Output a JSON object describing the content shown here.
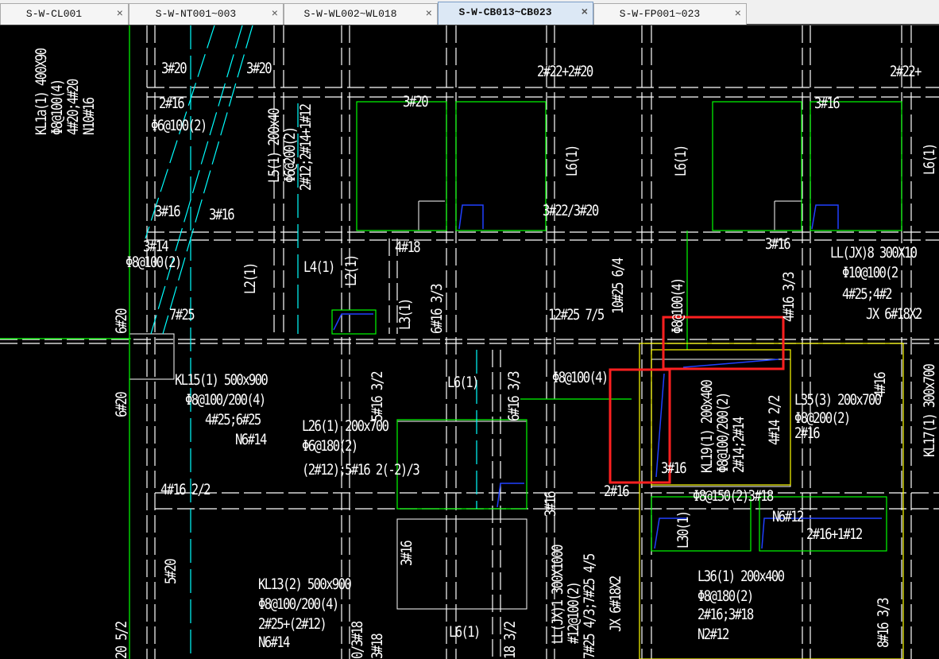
{
  "tabs": [
    {
      "label": "S-W-CL001",
      "active": false
    },
    {
      "label": "S-W-NT001~003",
      "active": false
    },
    {
      "label": "S-W-WL002~WL018",
      "active": false
    },
    {
      "label": "S-W-CB013~CB023",
      "active": true
    },
    {
      "label": "S-W-FP001~023",
      "active": false
    }
  ],
  "close_glyph": "×",
  "labels": [
    "3#20",
    "3#20",
    "2#22+2#20",
    "2#22+",
    "2#16",
    "Φ6@100(2)",
    "3#20",
    "3#16",
    "3#16",
    "3#16",
    "3#22/3#20",
    "3#14",
    "Φ8@100(2)",
    "4#18",
    "3#16",
    "LL(JX)8 300X10",
    "Φ10@100(2",
    "4#25;4#2",
    "JX 6#18X2",
    "7#25",
    "12#25 7/5",
    "KL15(1) 500x900",
    "Φ8@100/200(4)",
    "4#25;6#25",
    "N6#14",
    "L6(1)",
    "Φ8@100(4)",
    "L26(1) 200x700",
    "Φ6@180(2)",
    "(2#12);5#16 2(-2)/3",
    "L35(3) 200x700",
    "Φ8@200(2)",
    "2#16",
    "3#16",
    "4#16 2/2",
    "2#16",
    "Φ8@150(2)3#18",
    "N6#12",
    "2#16+1#12",
    "L36(1) 200x400",
    "Φ8@180(2)",
    "2#16;3#18",
    "N2#12",
    "KL13(2) 500x900",
    "Φ8@100/200(4)",
    "2#25+(2#12)",
    "N6#14",
    "L6(1)",
    "L4(1)"
  ],
  "vlabels": [
    "KL1a(1) 400X90",
    "Φ8@100(4)",
    "4#20;4#20",
    "N10#16",
    "L5(1) 200x40",
    "Φ6@200(2)",
    "2#12;2#14+1#12",
    "L6(1)",
    "L6(1)",
    "L2(1)",
    "L2(1)",
    "L3(1)",
    "6#16 3/3",
    "10#25 6/4",
    "Φ8@100(4)",
    "4#16 3/3",
    "6#20",
    "6#20",
    "5#16 3/2",
    "6#16 3/3",
    "KL19(1) 200x400",
    "Φ8@100/200(2)",
    "2#14;2#14",
    "4#14 2/2",
    "4#16",
    "KL17(1) 300x700",
    "L30(1)",
    "3#16",
    "LL(JX)1 300X1000",
    "#12@100(2)",
    "7#25 4/3;7#25 4/5",
    "JX 6#18X2",
    "5#20",
    "3#16",
    "3#18",
    "0/3#18",
    "18 3/2",
    "20 5/2",
    "8#16 3/3",
    "L6(1)"
  ],
  "colors": {
    "highlight": "#ff2020",
    "green": "#00ff00",
    "cyan": "#00ffff",
    "yellow": "#ffff00",
    "blue": "#2040ff"
  }
}
